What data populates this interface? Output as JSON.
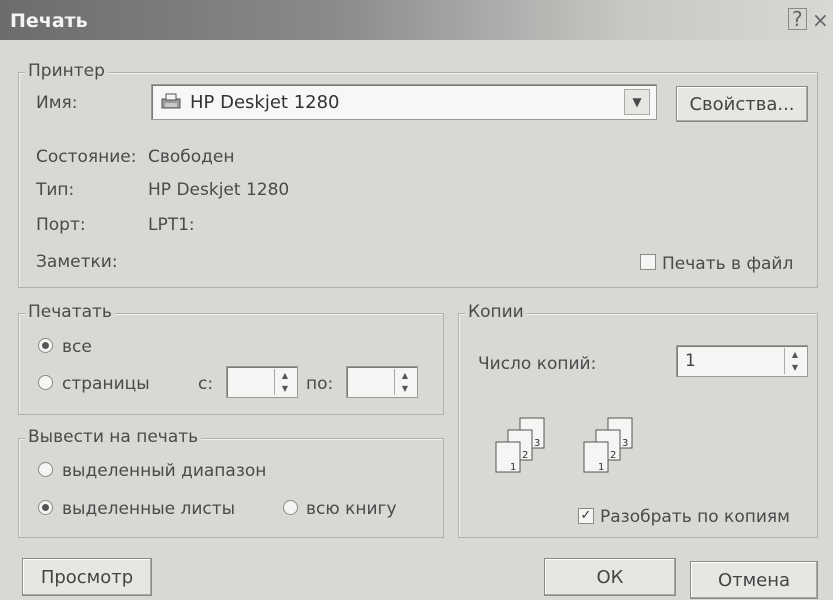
{
  "window": {
    "title": "Печать",
    "help": "?",
    "close": "×"
  },
  "printer": {
    "legend": "Принтер",
    "name_label": "Имя:",
    "name_value": "HP Deskjet 1280",
    "properties_button": "Свойства...",
    "status_label": "Состояние:",
    "status_value": "Свободен",
    "type_label": "Тип:",
    "type_value": "HP Deskjet 1280",
    "port_label": "Порт:",
    "port_value": "LPT1:",
    "notes_label": "Заметки:",
    "print_to_file_label": "Печать в файл",
    "print_to_file_checked": false
  },
  "range": {
    "legend": "Печатать",
    "all_label": "все",
    "pages_label": "страницы",
    "from_label": "с:",
    "to_label": "по:",
    "from_value": "",
    "to_value": "",
    "selected": "all"
  },
  "output": {
    "legend": "Вывести на печать",
    "selection_label": "выделенный диапазон",
    "sheets_label": "выделенные листы",
    "workbook_label": "всю книгу",
    "selected": "sheets"
  },
  "copies": {
    "legend": "Копии",
    "count_label": "Число копий:",
    "count_value": "1",
    "collate_label": "Разобрать по копиям",
    "collate_checked": true,
    "page_numbers": [
      "1",
      "2",
      "3"
    ]
  },
  "footer": {
    "preview_button": "Просмотр",
    "ok_button": "ОК",
    "cancel_button": "Отмена"
  }
}
